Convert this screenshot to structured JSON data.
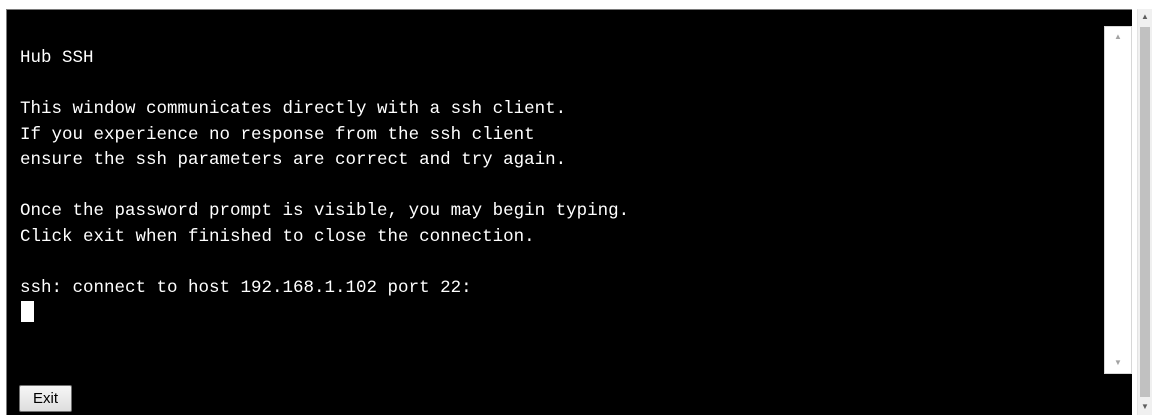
{
  "terminal": {
    "lines": [
      "Hub SSH",
      "",
      "This window communicates directly with a ssh client.",
      "If you experience no response from the ssh client",
      "ensure the ssh parameters are correct and try again.",
      "",
      "Once the password prompt is visible, you may begin typing.",
      "Click exit when finished to close the connection.",
      "",
      "ssh: connect to host 192.168.1.102 port 22:"
    ]
  },
  "controls": {
    "exit_label": "Exit"
  },
  "icons": {
    "scroll_up": "chevron-up-icon",
    "scroll_down": "chevron-down-icon"
  },
  "colors": {
    "terminal_bg": "#000000",
    "terminal_fg": "#ffffff"
  }
}
